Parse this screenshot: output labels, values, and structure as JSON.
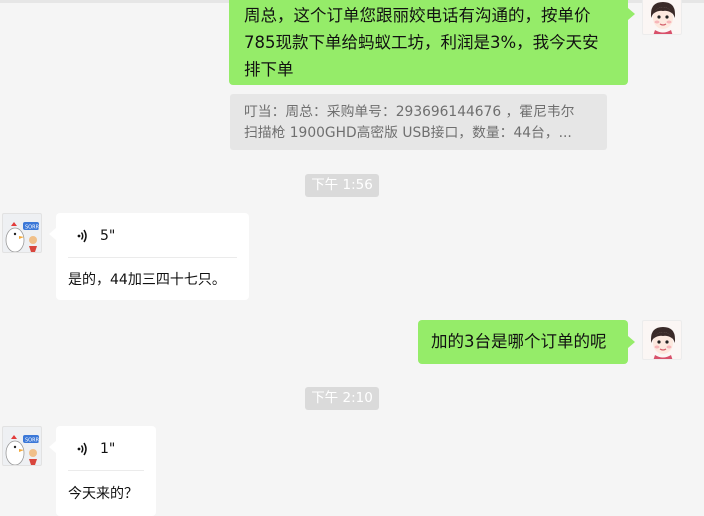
{
  "messages": {
    "msg1_lines": [
      "周总，这个订单您跟丽姣电话有沟通的，按单价",
      "785现款下单给蚂蚁工坊，利润是3%，我今天安",
      "排下单"
    ],
    "quote_lines": [
      "叮当：周总：采购单号：293696144676 ，霍尼韦尔",
      "扫描枪 1900GHD高密版 USB接口，数量：44台，..."
    ],
    "time1": "下午 1:56",
    "voice1_duration": "5\"",
    "voice1_text": "是的，44加三四十七只。",
    "msg2": "加的3台是哪个订单的呢",
    "time2": "下午 2:10",
    "voice2_duration": "1\"",
    "voice2_text": "今天来的？"
  },
  "colors": {
    "background": "#f5f5f5",
    "sent_bubble": "#95ec69",
    "received_bubble": "#ffffff",
    "quote_bg": "#e6e6e6",
    "timestamp_bg": "#dadada"
  },
  "icons": {
    "voice": "voice-wave-icon",
    "user_avatar": "girl-avatar-icon",
    "contact_avatar": "cartoon-chicken-avatar-icon"
  }
}
